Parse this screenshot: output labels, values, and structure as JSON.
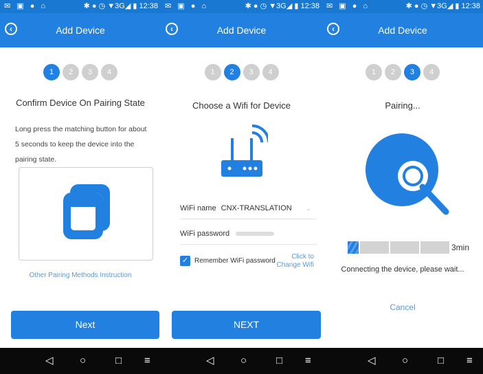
{
  "statusbar": {
    "left_icons": "✉ ▣ ● ⌂",
    "right_status": "✱ ● ◷ ▼3G◢ ▮ 12:38"
  },
  "screens": [
    {
      "title": "Add Device",
      "steps": [
        "1",
        "2",
        "3",
        "4"
      ],
      "active_step": 1,
      "heading": "Confirm Device On Pairing State",
      "description": "Long press the matching button for about 5 seconds to keep the device into the pairing state.",
      "link": "Other Pairing Methods Instruction",
      "button": "Next"
    },
    {
      "title": "Add Device",
      "steps": [
        "1",
        "2",
        "3",
        "4"
      ],
      "active_step": 2,
      "heading": "Choose a Wifi for Device",
      "wifi_name_label": "WiFi name",
      "wifi_name_value": "CNX-TRANSLATION",
      "wifi_password_label": "WiFi password",
      "remember_label": "Remember WiFi password",
      "change_wifi_link": "Click to Change Wifi",
      "button": "NEXT"
    },
    {
      "title": "Add Device",
      "steps": [
        "1",
        "2",
        "3",
        "4"
      ],
      "active_step": 3,
      "heading": "Pairing...",
      "progress_fraction": 0.1,
      "time_remaining": "3min",
      "status": "Connecting the device, please wait...",
      "cancel": "Cancel"
    }
  ],
  "icons": {
    "back": "chevron-left-icon",
    "checkmark": "✓",
    "nav_back": "◁",
    "nav_home": "○",
    "nav_recent": "□",
    "nav_extra": "≡"
  },
  "colors": {
    "primary": "#2180e0",
    "statusbar": "#1979d2",
    "link": "#5a9ad8",
    "step_inactive": "#cfcfcf"
  }
}
